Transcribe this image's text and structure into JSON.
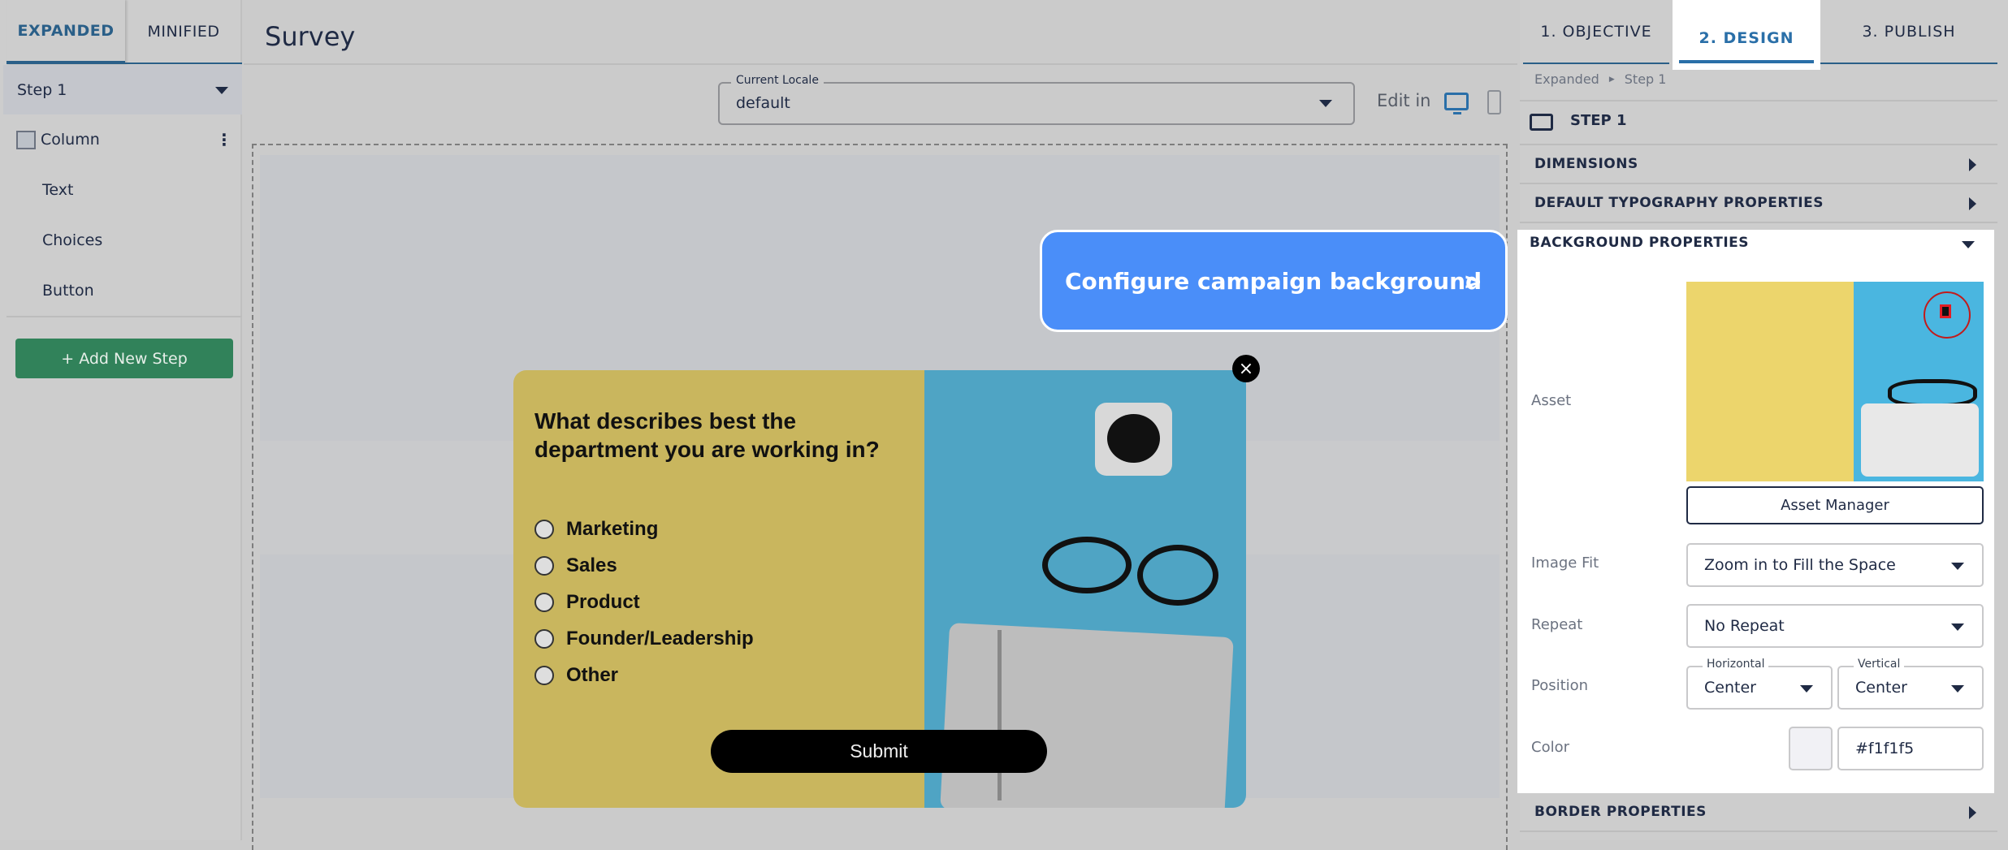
{
  "left_panel": {
    "tabs": [
      {
        "label": "EXPANDED",
        "active": true
      },
      {
        "label": "MINIFIED",
        "active": false
      }
    ],
    "step": {
      "label": "Step 1"
    },
    "items": [
      {
        "label": "Column"
      },
      {
        "label": "Text"
      },
      {
        "label": "Choices"
      },
      {
        "label": "Button"
      }
    ],
    "add_step_label": "+ Add New Step"
  },
  "header": {
    "title": "Survey"
  },
  "locale": {
    "label": "Current Locale",
    "value": "default"
  },
  "edit_in": {
    "label": "Edit in",
    "devices": [
      "desktop-icon",
      "mobile-icon"
    ],
    "active": "desktop"
  },
  "popup": {
    "question": "What describes best the department you are working in?",
    "options": [
      "Marketing",
      "Sales",
      "Product",
      "Founder/Leadership",
      "Other"
    ],
    "submit_label": "Submit",
    "close_label": "×"
  },
  "callout": {
    "text": "Configure campaign background",
    "arrow": ">"
  },
  "right_panel": {
    "tabs": [
      {
        "label": "1. OBJECTIVE"
      },
      {
        "label": "2. DESIGN",
        "active": true
      },
      {
        "label": "3. PUBLISH"
      }
    ],
    "breadcrumb": [
      "Expanded",
      "Step 1"
    ],
    "step_title": "STEP 1",
    "sections": {
      "dimensions": "DIMENSIONS",
      "typography": "DEFAULT TYPOGRAPHY PROPERTIES",
      "background": "BACKGROUND PROPERTIES",
      "border": "BORDER PROPERTIES"
    },
    "background": {
      "asset_label": "Asset",
      "asset_manager_label": "Asset Manager",
      "image_fit_label": "Image Fit",
      "image_fit_value": "Zoom in to Fill the Space",
      "repeat_label": "Repeat",
      "repeat_value": "No Repeat",
      "position_label": "Position",
      "horizontal_label": "Horizontal",
      "horizontal_value": "Center",
      "vertical_label": "Vertical",
      "vertical_value": "Center",
      "color_label": "Color",
      "color_value": "#f1f1f5"
    }
  },
  "colors": {
    "accent": "#2a6fa8",
    "green": "#31825a",
    "callout": "#4a8ef9",
    "delete": "#e11d24"
  }
}
